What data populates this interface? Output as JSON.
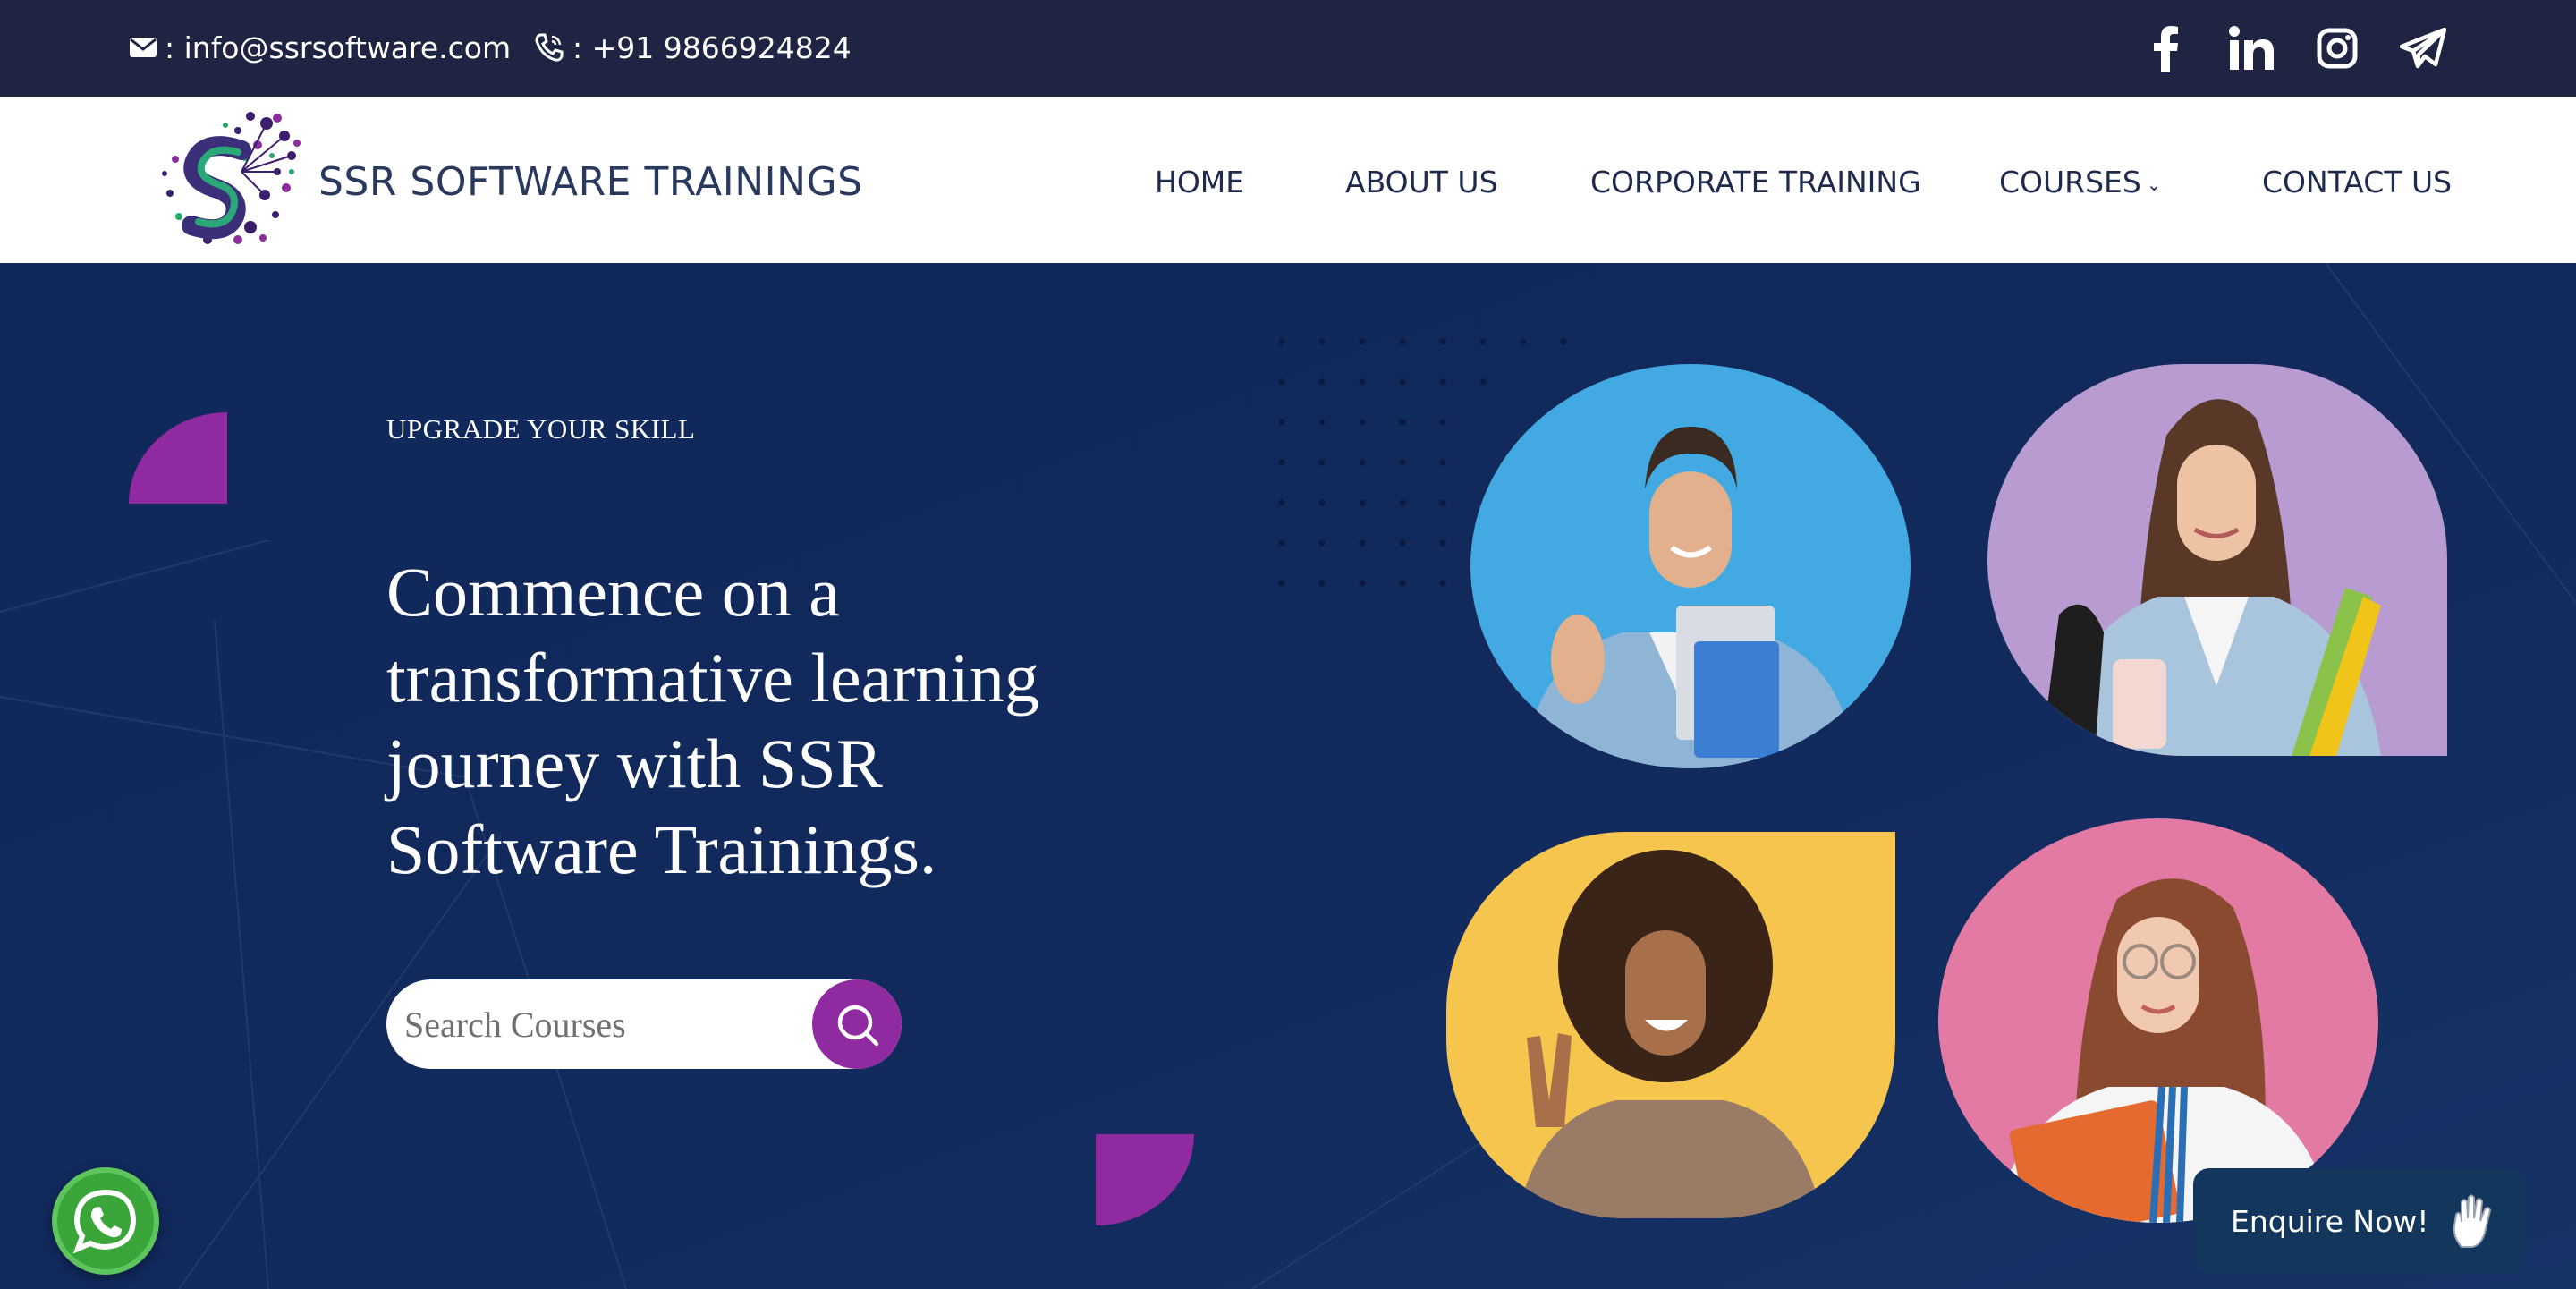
{
  "topbar": {
    "email": ": info@ssrsoftware.com",
    "phone": ": +91 9866924824",
    "social_icons": [
      "facebook-icon",
      "linkedin-icon",
      "instagram-icon",
      "telegram-icon"
    ]
  },
  "header": {
    "brand": "SSR SOFTWARE TRAININGS",
    "nav": {
      "home": "HOME",
      "about": "ABOUT US",
      "corporate": "CORPORATE TRAINING",
      "courses": "COURSES",
      "contact": "CONTACT US"
    }
  },
  "hero": {
    "eyebrow": "UPGRADE YOUR SKILL",
    "headline": "Commence on a transformative learning journey with SSR Software Trainings.",
    "search": {
      "placeholder": "Search Courses",
      "value": ""
    }
  },
  "widgets": {
    "enquire": "Enquire Now!"
  },
  "colors": {
    "topbar": "#1e2442",
    "hero": "#12295c",
    "accent": "#8f2aa0",
    "nav_text": "#1f2b4c"
  }
}
